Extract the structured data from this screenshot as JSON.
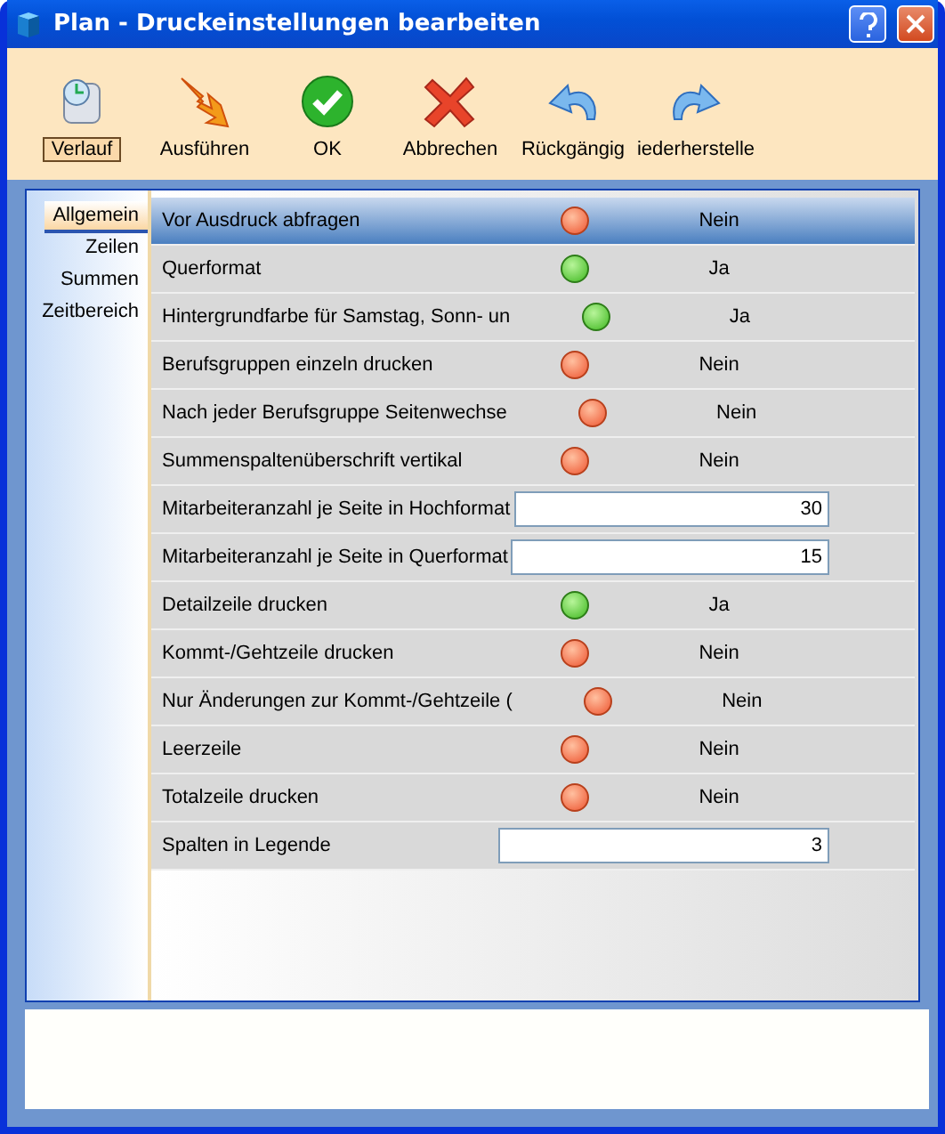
{
  "window": {
    "title": "Plan - Druckeinstellungen bearbeiten"
  },
  "toolbar": [
    {
      "kind": "history",
      "label": "Verlauf",
      "focused": true
    },
    {
      "kind": "run",
      "label": "Ausführen",
      "focused": false
    },
    {
      "kind": "ok",
      "label": "OK",
      "focused": false
    },
    {
      "kind": "cancel",
      "label": "Abbrechen",
      "focused": false
    },
    {
      "kind": "undo",
      "label": "Rückgängig",
      "focused": false
    },
    {
      "kind": "redo",
      "label": "iederherstelle",
      "focused": false
    }
  ],
  "tabs": [
    {
      "label": "Allgemein",
      "selected": true
    },
    {
      "label": "Zeilen",
      "selected": false
    },
    {
      "label": "Summen",
      "selected": false
    },
    {
      "label": "Zeitbereich",
      "selected": false
    }
  ],
  "rows": [
    {
      "kind": "toggle",
      "label": "Vor Ausdruck abfragen",
      "on": false,
      "value": "Nein",
      "selected": true
    },
    {
      "kind": "toggle",
      "label": "Querformat",
      "on": true,
      "value": "Ja",
      "selected": false
    },
    {
      "kind": "toggle",
      "label": "Hintergrundfarbe für Samstag, Sonn- un",
      "on": true,
      "value": "Ja",
      "selected": false
    },
    {
      "kind": "toggle",
      "label": "Berufsgruppen einzeln drucken",
      "on": false,
      "value": "Nein",
      "selected": false
    },
    {
      "kind": "toggle",
      "label": "Nach jeder Berufsgruppe Seitenwechse",
      "on": false,
      "value": "Nein",
      "selected": false
    },
    {
      "kind": "toggle",
      "label": "Summenspaltenüberschrift vertikal",
      "on": false,
      "value": "Nein",
      "selected": false
    },
    {
      "kind": "number",
      "label": "Mitarbeiteranzahl je Seite in Hochformat",
      "value": "30",
      "selected": false
    },
    {
      "kind": "number",
      "label": "Mitarbeiteranzahl je Seite in Querformat",
      "value": "15",
      "selected": false
    },
    {
      "kind": "toggle",
      "label": "Detailzeile drucken",
      "on": true,
      "value": "Ja",
      "selected": false
    },
    {
      "kind": "toggle",
      "label": "Kommt-/Gehtzeile drucken",
      "on": false,
      "value": "Nein",
      "selected": false
    },
    {
      "kind": "toggle",
      "label": "Nur Änderungen zur Kommt-/Gehtzeile (",
      "on": false,
      "value": "Nein",
      "selected": false
    },
    {
      "kind": "toggle",
      "label": "Leerzeile",
      "on": false,
      "value": "Nein",
      "selected": false
    },
    {
      "kind": "toggle",
      "label": "Totalzeile drucken",
      "on": false,
      "value": "Nein",
      "selected": false
    },
    {
      "kind": "number",
      "label": "Spalten in Legende",
      "value": "3",
      "selected": false
    }
  ]
}
